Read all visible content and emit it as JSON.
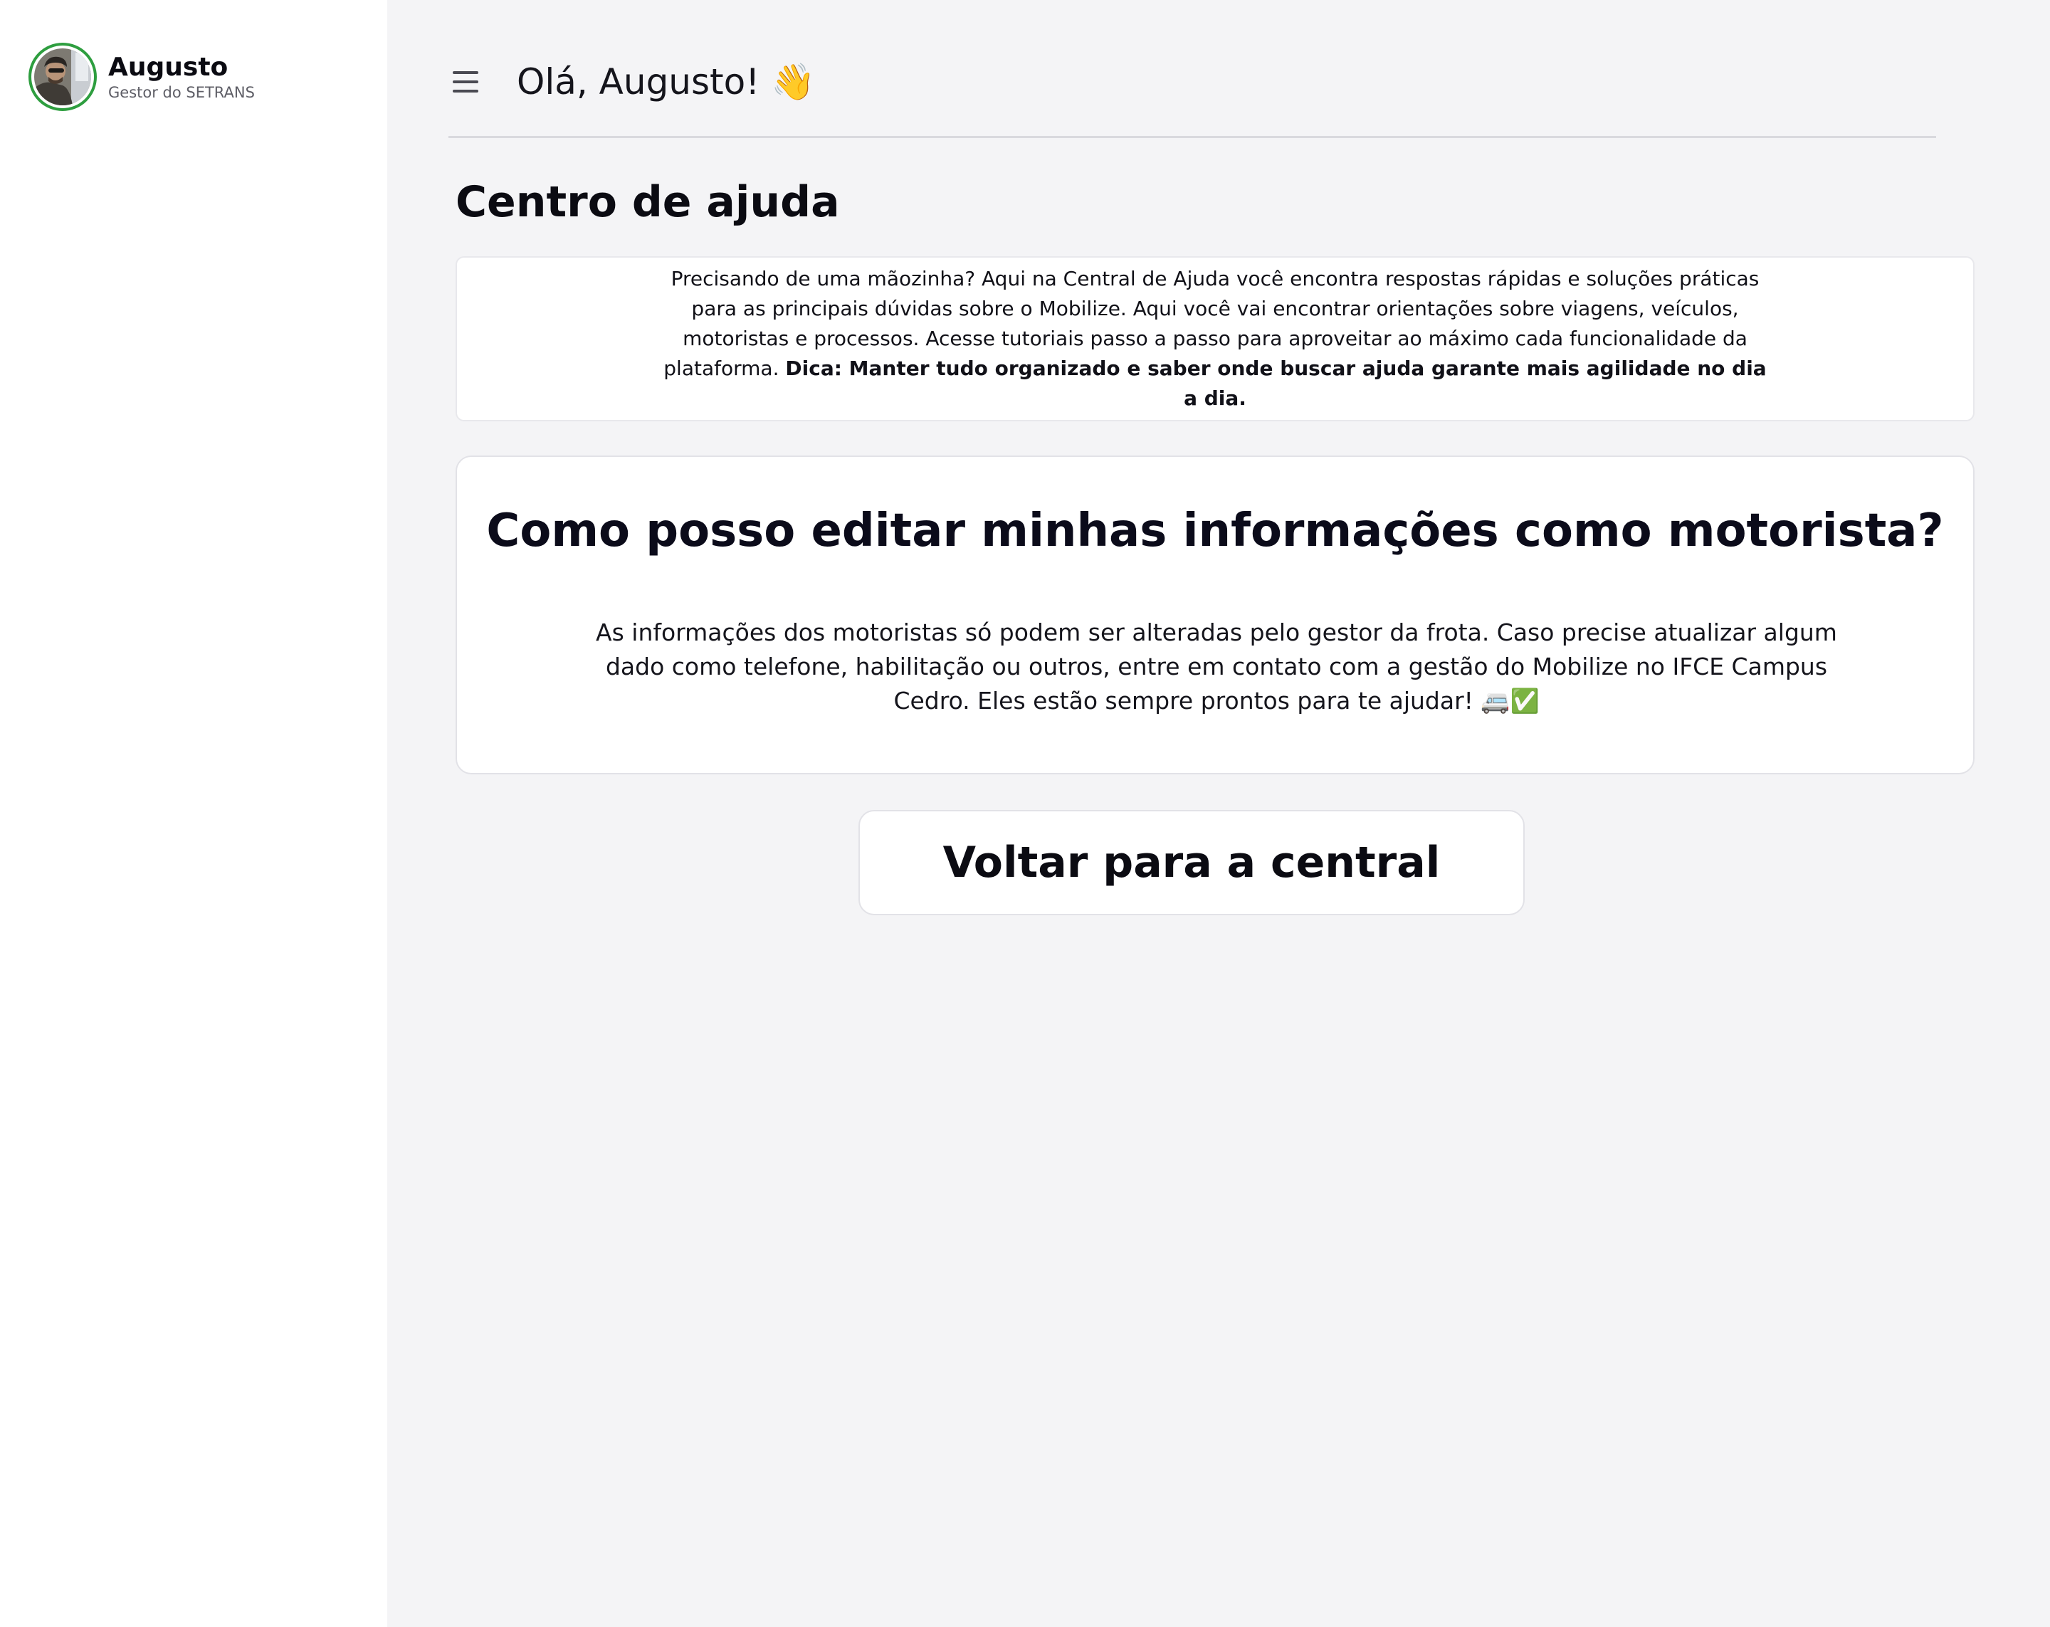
{
  "sidebar": {
    "profile": {
      "name": "Augusto",
      "role": "Gestor do SETRANS",
      "avatar_border_color": "#2e9e3f"
    }
  },
  "header": {
    "menu_icon": "hamburger-menu-icon",
    "greeting": "Olá, Augusto! 👋"
  },
  "page": {
    "title": "Centro de ajuda",
    "intro_text": "Precisando de uma mãozinha? Aqui na Central de Ajuda você encontra respostas rápidas e soluções práticas para as principais dúvidas sobre o Mobilize. Aqui você vai encontrar orientações sobre viagens, veículos, motoristas e processos. Acesse tutoriais passo a passo para aproveitar ao máximo cada funcionalidade da plataforma.",
    "intro_tip": "Dica: Manter tudo organizado e saber onde buscar ajuda garante mais agilidade no dia a dia."
  },
  "faq": {
    "question": "Como posso editar minhas informações como motorista?",
    "answer": "As informações dos motoristas só podem ser alteradas pelo gestor da frota. Caso precise atualizar algum dado como telefone, habilitação ou outros, entre em contato com a gestão do Mobilize no IFCE Campus Cedro. Eles estão sempre prontos para te ajudar! 🚐✅"
  },
  "actions": {
    "back_label": "Voltar para a central"
  },
  "colors": {
    "sidebar_bg": "#ffffff",
    "main_bg": "#f4f4f6",
    "card_bg": "#ffffff",
    "accent_green": "#2e9e3f"
  }
}
